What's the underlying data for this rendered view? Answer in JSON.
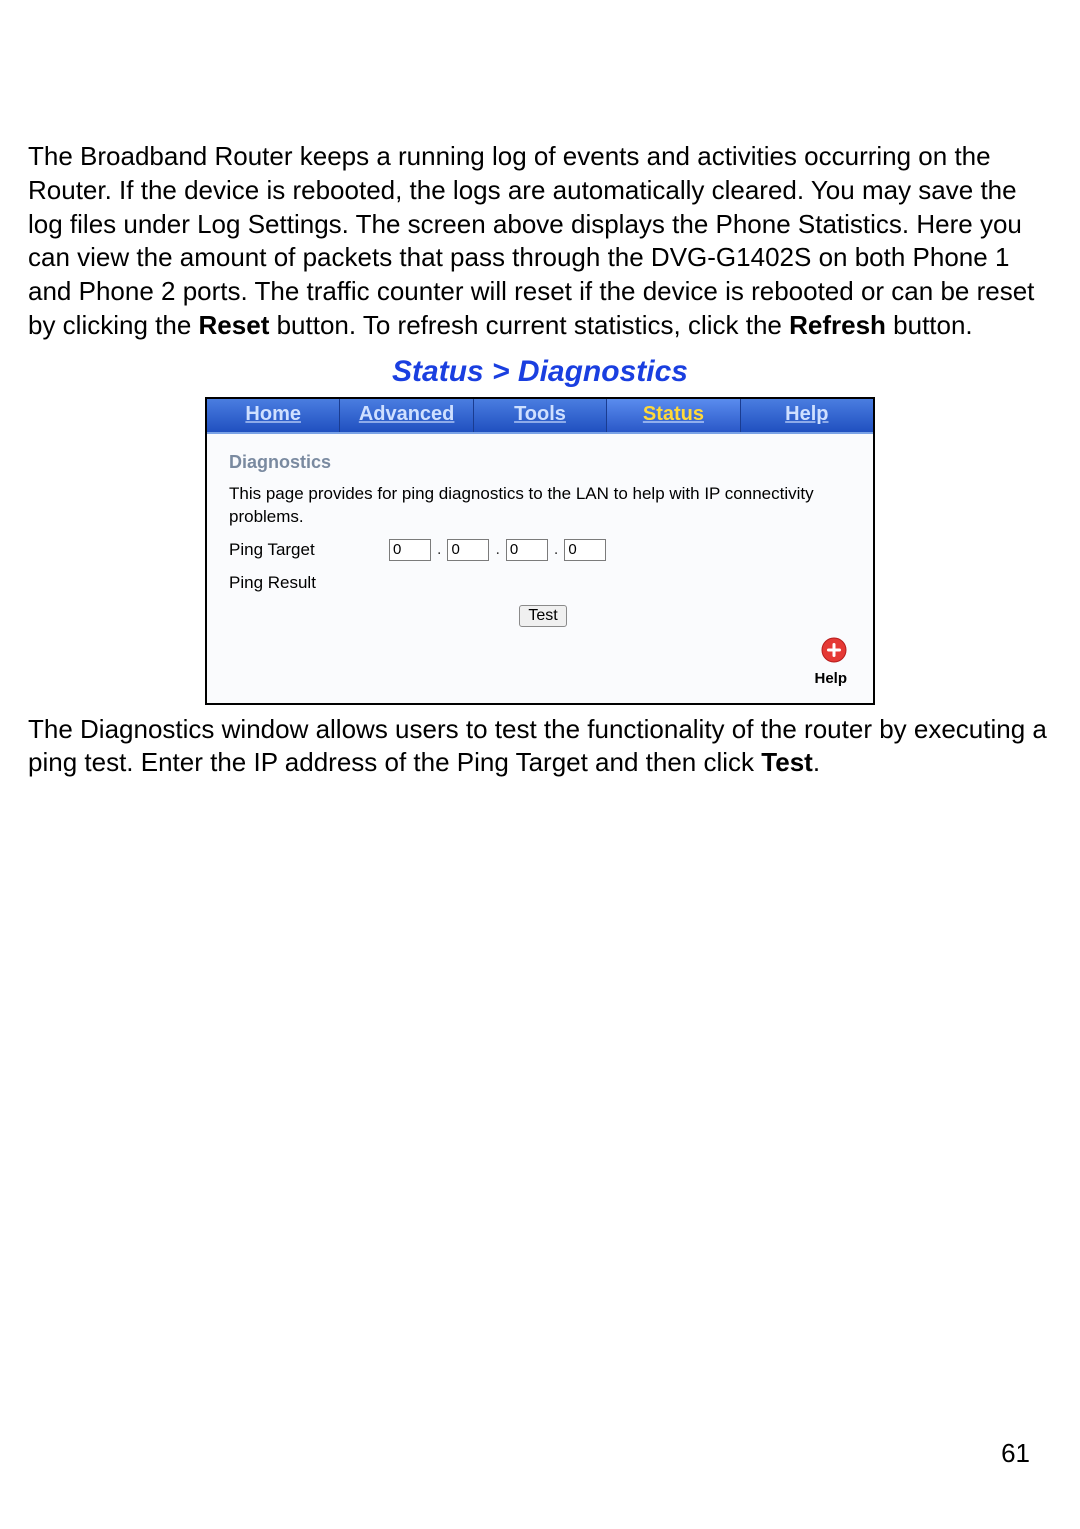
{
  "intro": {
    "text_before_reset": "The Broadband Router keeps a running log of events and activities occurring on the Router. If the device is rebooted, the logs are automatically cleared. You may save the log files under Log Settings. The screen above displays the Phone Statistics. Here you can view the amount of packets that pass through the DVG-G1402S on both Phone 1 and Phone 2 ports. The traffic counter will reset if the device is rebooted or can be reset by clicking the ",
    "reset_word": "Reset",
    "text_mid": " button. To refresh current statistics, click the ",
    "refresh_word": "Refresh",
    "text_after": " button."
  },
  "heading": "Status > Diagnostics",
  "tabs": {
    "home": "Home",
    "advanced": "Advanced",
    "tools": "Tools",
    "status": "Status",
    "help": "Help"
  },
  "panel": {
    "title": "Diagnostics",
    "desc": "This page provides for ping diagnostics to the LAN to help with IP connectivity problems.",
    "ping_target_label": "Ping Target",
    "ip": {
      "a": "0",
      "b": "0",
      "c": "0",
      "d": "0"
    },
    "ping_result_label": "Ping Result",
    "test_button": "Test",
    "help_label": "Help"
  },
  "outro": {
    "text_before_test": "The Diagnostics window allows users to test the functionality of the router by executing a ping test. Enter the IP address of the Ping Target and then click ",
    "test_word": "Test",
    "text_after": "."
  },
  "page_number": "61"
}
